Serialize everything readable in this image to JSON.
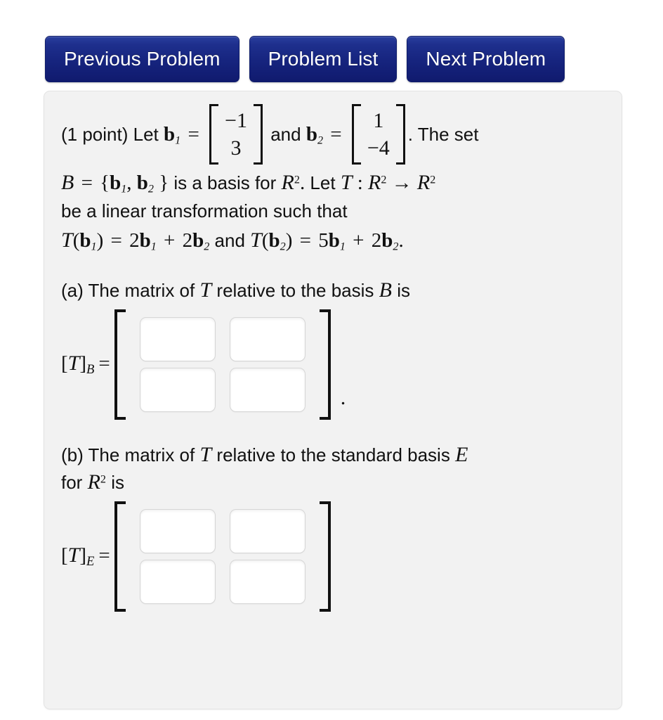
{
  "nav": {
    "buttons": [
      {
        "label": "Previous Problem",
        "name": "previous-problem-button"
      },
      {
        "label": "Problem List",
        "name": "problem-list-button"
      },
      {
        "label": "Next Problem",
        "name": "next-problem-button"
      }
    ]
  },
  "problem": {
    "points_label": "(1 point)",
    "intro_let": "Let",
    "b1_symbol": "b",
    "b1_sub": "1",
    "b1_vector": [
      "−1",
      "3"
    ],
    "and_word": "and",
    "b2_symbol": "b",
    "b2_sub": "2",
    "b2_vector": [
      "1",
      "−4"
    ],
    "the_set": ". The set",
    "basis_B": "B",
    "basis_eq": "=",
    "basis_open": "{",
    "basis_close": "}",
    "basis_comma": ",",
    "is_a_basis_for": "is a basis for",
    "R_symbol": "R",
    "R_exp": "2",
    "period_after_R": ".",
    "let_word": "Let",
    "T_symbol": "T",
    "colon": ":",
    "arrow": "→",
    "linear_line": "be a linear transformation such that",
    "def1": {
      "lhs_T": "T",
      "lhs_open": "(",
      "lhs_b": "b",
      "lhs_sub": "1",
      "lhs_close": ")",
      "eq": "=",
      "c1": "2",
      "t1_b": "b",
      "t1_sub": "1",
      "plus": "+",
      "c2": "2",
      "t2_b": "b",
      "t2_sub": "2"
    },
    "and_between": "and",
    "def2": {
      "lhs_T": "T",
      "lhs_open": "(",
      "lhs_b": "b",
      "lhs_sub": "2",
      "lhs_close": ")",
      "eq": "=",
      "c1": "5",
      "t1_b": "b",
      "t1_sub": "1",
      "plus": "+",
      "c2": "2",
      "t2_b": "b",
      "t2_sub": "2",
      "trailing_period": "."
    }
  },
  "part_a": {
    "prompt_pre": "(a) The matrix of",
    "prompt_T": "T",
    "prompt_mid": "relative to the basis",
    "prompt_B": "B",
    "prompt_post": "is",
    "label_open": "[",
    "label_T": "T",
    "label_close": "]",
    "label_sub": "B",
    "label_eq": "=",
    "answers": [
      {
        "value": "",
        "placeholder": ""
      },
      {
        "value": "",
        "placeholder": ""
      },
      {
        "value": "",
        "placeholder": ""
      },
      {
        "value": "",
        "placeholder": ""
      }
    ],
    "trailing_period": "."
  },
  "part_b": {
    "prompt_pre": "(b) The matrix of",
    "prompt_T": "T",
    "prompt_mid": "relative to the standard basis",
    "prompt_E": "E",
    "prompt_line2_for": "for",
    "prompt_R": "R",
    "prompt_R_exp": "2",
    "prompt_post": "is",
    "label_open": "[",
    "label_T": "T",
    "label_close": "]",
    "label_sub": "E",
    "label_eq": "=",
    "answers": [
      {
        "value": "",
        "placeholder": ""
      },
      {
        "value": "",
        "placeholder": ""
      },
      {
        "value": "",
        "placeholder": ""
      },
      {
        "value": "",
        "placeholder": ""
      }
    ]
  },
  "colors": {
    "button_blue": "#16247e",
    "panel_bg": "#f2f2f2",
    "text": "#111111",
    "input_border": "#d6d6d6"
  }
}
